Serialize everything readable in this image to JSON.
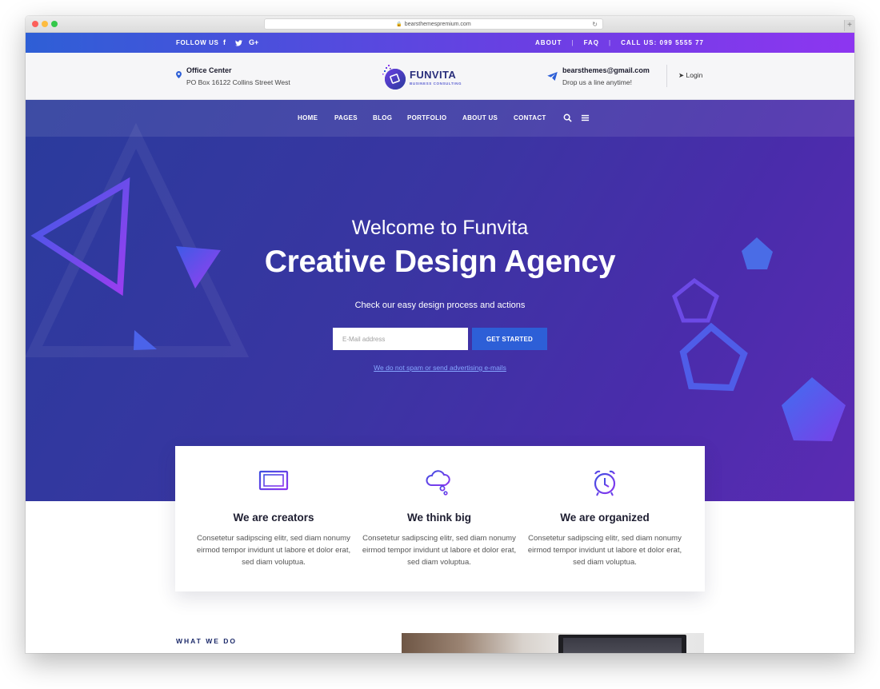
{
  "browser": {
    "url": "bearsthemespremium.com"
  },
  "topbar": {
    "follow_label": "FOLLOW US",
    "social": [
      "f",
      "t",
      "G+"
    ],
    "links": {
      "about": "ABOUT",
      "faq": "FAQ",
      "call": "CALL US: 099 5555 77"
    }
  },
  "header": {
    "office_title": "Office Center",
    "office_address": "PO Box 16122 Collins Street West",
    "logo_name": "FUNVITA",
    "logo_tagline": "BUSINESS CONSULTING",
    "email": "bearsthemes@gmail.com",
    "email_sub": "Drop us a line anytime!",
    "login": "Login"
  },
  "nav": {
    "items": [
      "HOME",
      "PAGES",
      "BLOG",
      "PORTFOLIO",
      "ABOUT US",
      "CONTACT"
    ]
  },
  "hero": {
    "welcome": "Welcome to Funvita",
    "headline": "Creative Design Agency",
    "subline": "Check our easy design process and actions",
    "email_placeholder": "E-Mail address",
    "cta": "GET STARTED",
    "nospam": "We do not spam or send advertising e-mails"
  },
  "features": [
    {
      "icon": "monitor-icon",
      "title": "We are creators",
      "text": "Consetetur sadipscing elitr, sed diam nonumy eirmod tempor invidunt ut labore et dolor erat, sed diam voluptua."
    },
    {
      "icon": "cloud-icon",
      "title": "We think big",
      "text": "Consetetur sadipscing elitr, sed diam nonumy eirmod tempor invidunt ut labore et dolor erat, sed diam voluptua."
    },
    {
      "icon": "alarm-clock-icon",
      "title": "We are organized",
      "text": "Consetetur sadipscing elitr, sed diam nonumy eirmod tempor invidunt ut labore et dolor erat, sed diam voluptua."
    }
  ],
  "section": {
    "what_we_do": "WHAT WE DO"
  },
  "colors": {
    "accent": "#2d5fd7",
    "purple": "#8d36f0",
    "navy": "#2a2f7c"
  }
}
